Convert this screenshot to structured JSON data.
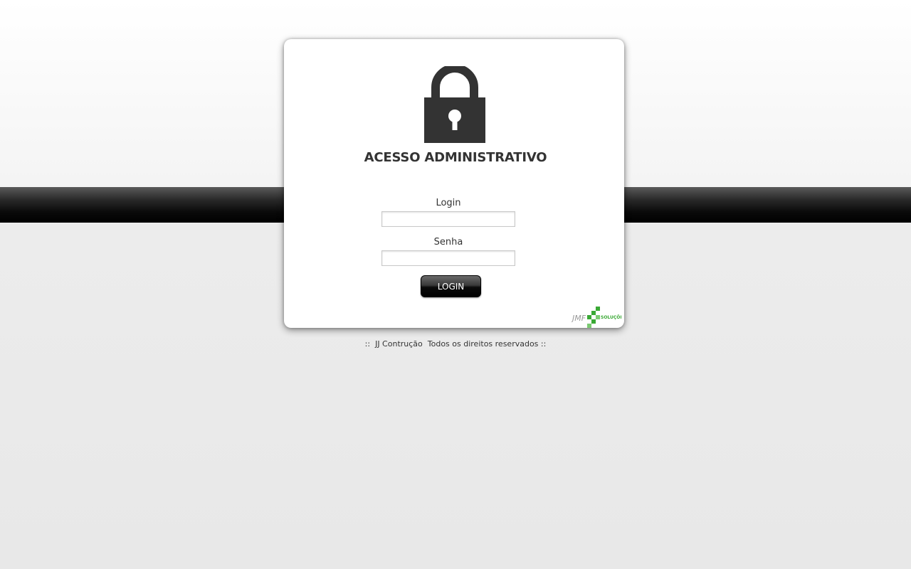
{
  "title": "ACESSO ADMINISTRATIVO",
  "form": {
    "login_label": "Login",
    "login_value": "",
    "senha_label": "Senha",
    "senha_value": "",
    "submit_label": "LOGIN"
  },
  "footer": {
    "text": "::  JJ Contrução  Todos os direitos reservados ::"
  },
  "icons": {
    "lock": "lock-icon",
    "logo": "jmf-solucoes-logo"
  },
  "colors": {
    "lock": "#333333",
    "band": "#000000",
    "button": "#000000",
    "logo_green": "#3aa935"
  }
}
